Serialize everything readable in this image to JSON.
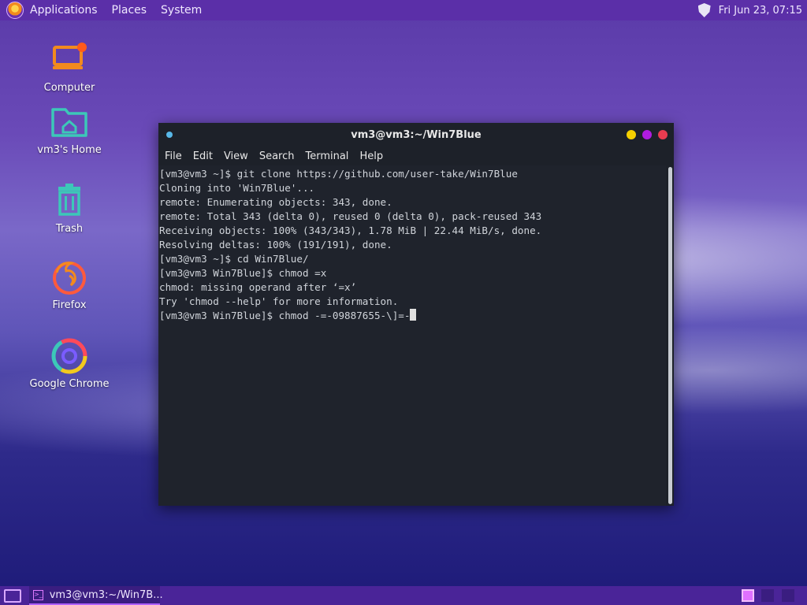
{
  "top_panel": {
    "menus": [
      "Applications",
      "Places",
      "System"
    ],
    "clock": "Fri Jun 23, 07:15"
  },
  "desktop": {
    "icons": [
      {
        "label": "Computer",
        "icon": "computer-icon"
      },
      {
        "label": "vm3's Home",
        "icon": "home-folder-icon"
      },
      {
        "label": "Trash",
        "icon": "trash-icon"
      },
      {
        "label": "Firefox",
        "icon": "firefox-icon"
      },
      {
        "label": "Google Chrome",
        "icon": "chrome-icon"
      }
    ]
  },
  "terminal": {
    "title": "vm3@vm3:~/Win7Blue",
    "menu": [
      "File",
      "Edit",
      "View",
      "Search",
      "Terminal",
      "Help"
    ],
    "lines": [
      "[vm3@vm3 ~]$ git clone https://github.com/user-take/Win7Blue",
      "Cloning into 'Win7Blue'...",
      "remote: Enumerating objects: 343, done.",
      "remote: Total 343 (delta 0), reused 0 (delta 0), pack-reused 343",
      "Receiving objects: 100% (343/343), 1.78 MiB | 22.44 MiB/s, done.",
      "Resolving deltas: 100% (191/191), done.",
      "[vm3@vm3 ~]$ cd Win7Blue/",
      "[vm3@vm3 Win7Blue]$ chmod =x",
      "chmod: missing operand after ‘=x’",
      "Try 'chmod --help' for more information."
    ],
    "prompt_line": "[vm3@vm3 Win7Blue]$ chmod -=-09887655-\\]=-",
    "window_buttons": {
      "minimize": "#f5d000",
      "maximize": "#b01ce0",
      "close": "#e83c50"
    }
  },
  "taskbar": {
    "task_label": "vm3@vm3:~/Win7B..."
  },
  "colors": {
    "top_panel": "#5b2fa8",
    "bottom_panel": "#4a2498",
    "terminal_bg": "#1f232c"
  }
}
